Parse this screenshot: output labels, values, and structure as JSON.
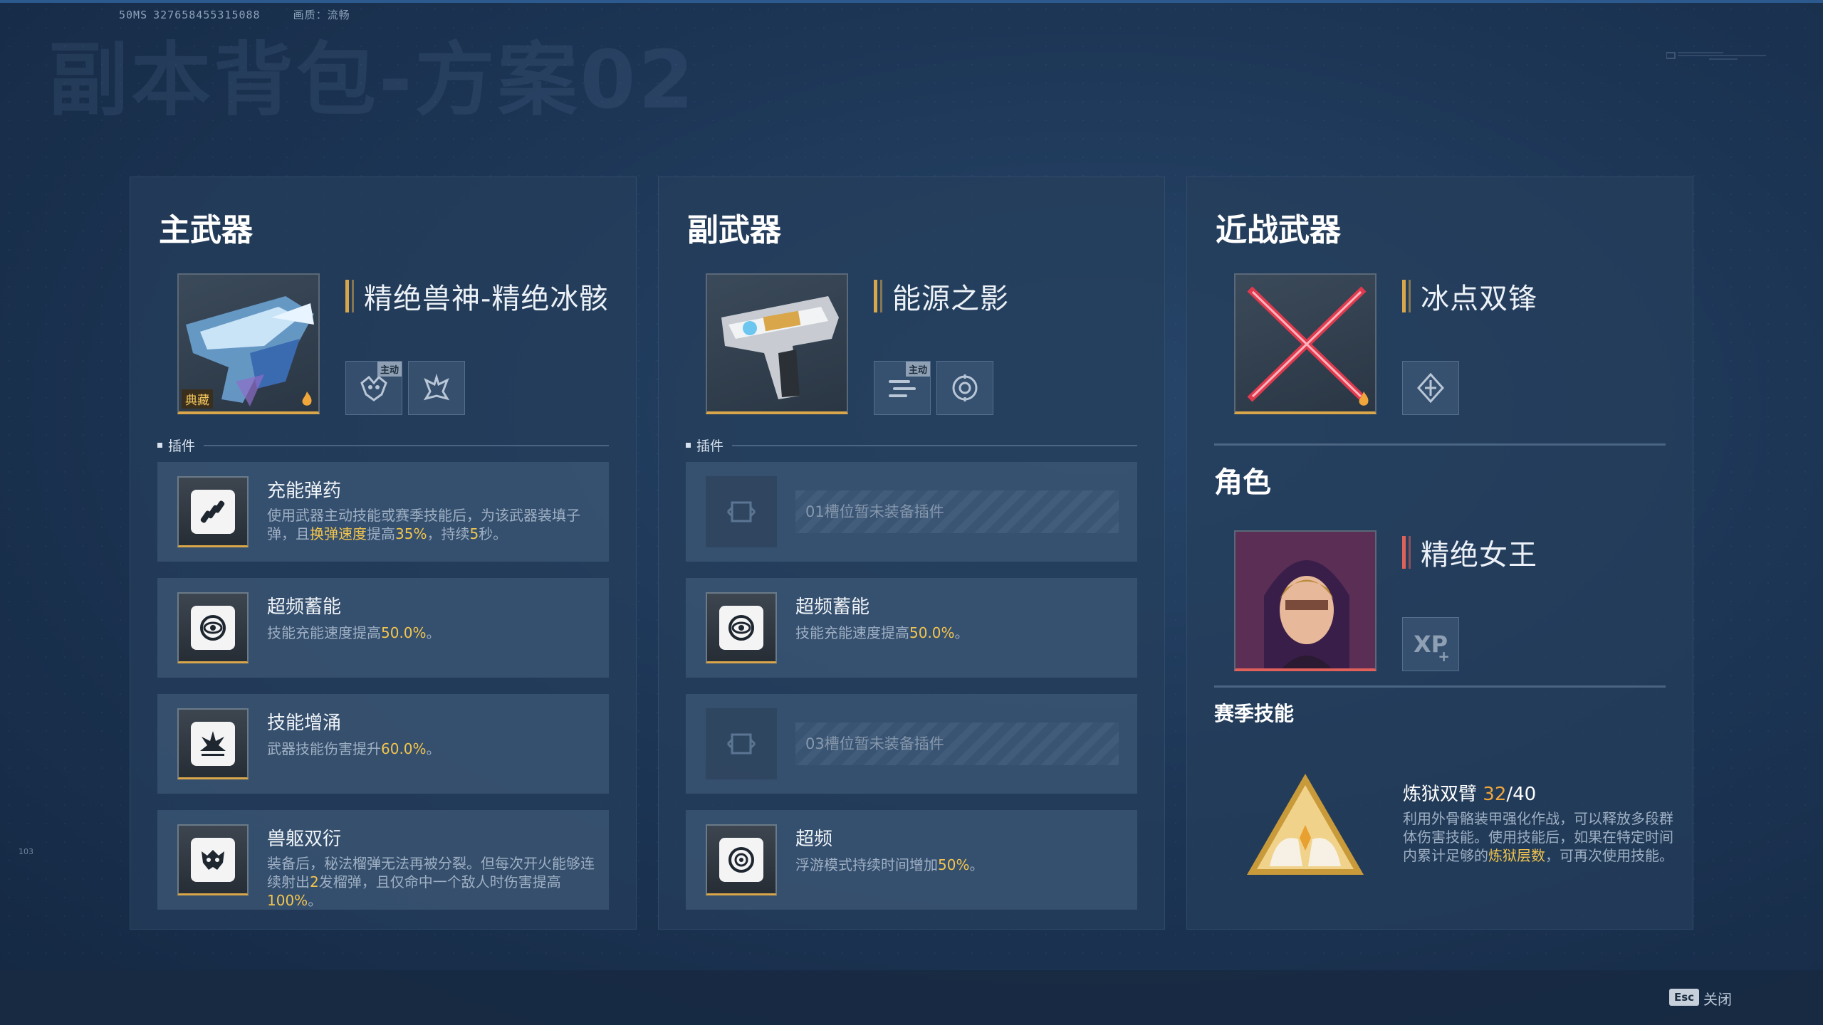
{
  "header": {
    "ping": "50MS",
    "id": "327658455315088",
    "quality_label": "画质：",
    "quality_value": "流畅",
    "bg_title": "副本背包-方案02"
  },
  "side_number": "103",
  "primary": {
    "title": "主武器",
    "weapon_name": "精绝兽神-精绝冰骸",
    "rarity_badge": "典藏",
    "active_tag": "主动",
    "name_bar_color": "#d9a64a",
    "plugins_label": "插件",
    "plugins": [
      {
        "name": "充能弹药",
        "d1": "使用武器主动技能或赛季技能后，为该武器装填子弹，且",
        "h1": "换弹速度",
        "d2": "提高",
        "h2": "35%",
        "d3": "，持续",
        "h3": "5",
        "d4": "秒。",
        "icon": "bullets-icon"
      },
      {
        "name": "超频蓄能",
        "d1": "技能充能速度提高",
        "h1": "50.0%",
        "d2": "。",
        "icon": "eye-swirl-icon"
      },
      {
        "name": "技能增涌",
        "d1": "武器技能伤害提升",
        "h1": "60.0%",
        "d2": "。",
        "icon": "burst-icon"
      },
      {
        "name": "兽躯双衍",
        "d1": "装备后，秘法榴弹无法再被分裂。但每次开火能够连续射出",
        "h1": "2",
        "d2": "发榴弹，且仅命中一个敌人时伤害提高",
        "h2": "100%",
        "d3": "。",
        "icon": "beast-skull-icon"
      }
    ]
  },
  "secondary": {
    "title": "副武器",
    "weapon_name": "能源之影",
    "active_tag": "主动",
    "name_bar_color": "#d9a64a",
    "plugins_label": "插件",
    "empty_slot_1": "01槽位暂未装备插件",
    "plugin_2": {
      "name": "超频蓄能",
      "d1": "技能充能速度提高",
      "h1": "50.0%",
      "d2": "。"
    },
    "empty_slot_3": "03槽位暂未装备插件",
    "plugin_4": {
      "name": "超频",
      "d1": "浮游模式持续时间增加",
      "h1": "50%",
      "d2": "。"
    }
  },
  "melee": {
    "title": "近战武器",
    "weapon_name": "冰点双锋",
    "name_bar_color": "#d9a64a"
  },
  "character": {
    "title": "角色",
    "name": "精绝女王",
    "name_bar_color": "#e0605a",
    "xp_label": "XP"
  },
  "season": {
    "title": "赛季技能",
    "skill_name": "炼狱双臂",
    "count_current": "32",
    "count_total": "/40",
    "d1": "利用外骨骼装甲强化作战，可以释放多段群体伤害技能。使用技能后，如果在特定时间内累计足够的",
    "h1": "炼狱层数",
    "d2": "，可再次使用技能。"
  },
  "footer": {
    "esc_key": "Esc",
    "close_label": "关闭"
  }
}
